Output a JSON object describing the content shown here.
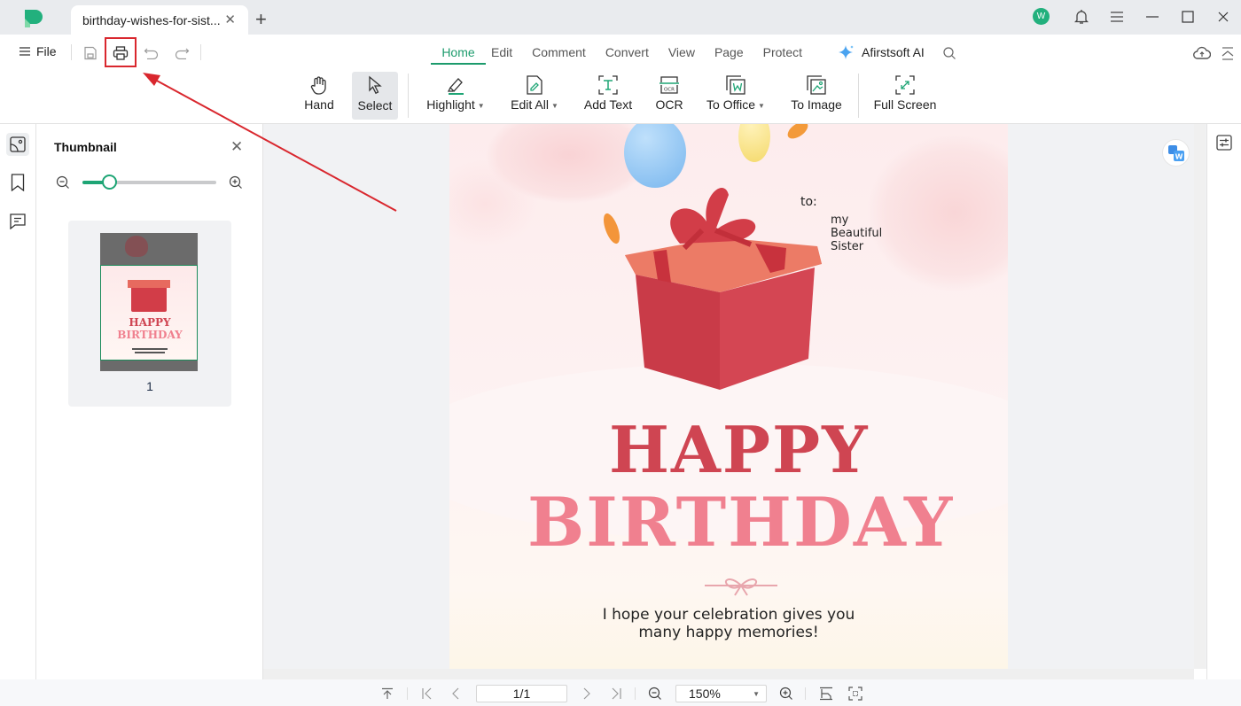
{
  "app": {
    "tab_title": "birthday-wishes-for-sist...",
    "user_initial": "W"
  },
  "menu": {
    "file_label": "File",
    "tabs": [
      {
        "label": "Home",
        "active": true
      },
      {
        "label": "Edit"
      },
      {
        "label": "Comment"
      },
      {
        "label": "Convert"
      },
      {
        "label": "View"
      },
      {
        "label": "Page"
      },
      {
        "label": "Protect"
      }
    ],
    "ai_label": "Afirstsoft AI"
  },
  "ribbon": {
    "hand": "Hand",
    "select": "Select",
    "highlight": "Highlight",
    "edit_all": "Edit All",
    "add_text": "Add Text",
    "ocr": "OCR",
    "to_office": "To Office",
    "to_image": "To Image",
    "full_screen": "Full Screen"
  },
  "thumbnail_panel": {
    "title": "Thumbnail",
    "zoom_level_fraction": 0.2,
    "pages": [
      {
        "number": "1"
      }
    ]
  },
  "document": {
    "to_label": "to:",
    "recipient": [
      "my",
      "Beautiful",
      "Sister"
    ],
    "headline_1": "HAPPY",
    "headline_2": "BIRTHDAY",
    "message_line_1": "I hope your celebration gives you",
    "message_line_2": "many happy memories!"
  },
  "statusbar": {
    "page_value": "1/1",
    "zoom_value": "150%"
  },
  "colors": {
    "accent": "#1ea575",
    "highlight_box": "#d9272e",
    "headline_1": "#cf4552",
    "headline_2": "#f0808f"
  }
}
